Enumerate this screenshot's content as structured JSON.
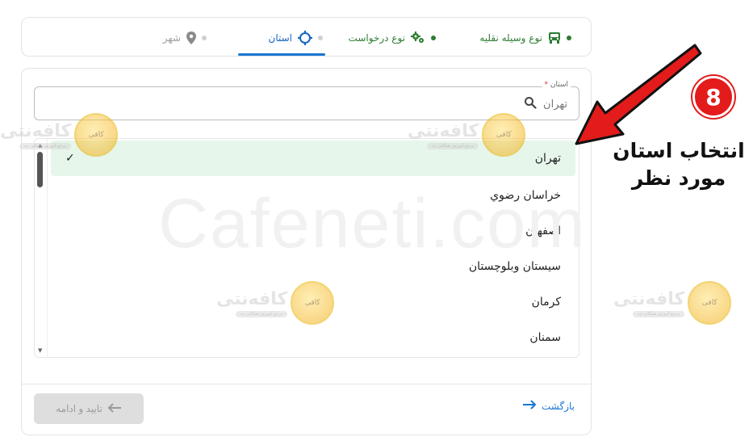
{
  "stepper": {
    "steps": [
      {
        "label": "نوع وسیله نقلیه",
        "icon": "car-icon",
        "state": "done"
      },
      {
        "label": "نوع درخواست",
        "icon": "gears-icon",
        "state": "done"
      },
      {
        "label": "استان",
        "icon": "crosshair-icon",
        "state": "current"
      },
      {
        "label": "شهر",
        "icon": "map-pin-icon",
        "state": "pending"
      }
    ]
  },
  "province_field": {
    "label": "استان",
    "required_mark": "*",
    "value": "تهران",
    "icon": "search-icon"
  },
  "province_list": {
    "options": [
      {
        "label": "تهران",
        "selected": true,
        "check": "✓"
      },
      {
        "label": "خراسان رضوي",
        "selected": false
      },
      {
        "label": "اصفهان",
        "selected": false
      },
      {
        "label": "سیستان وبلوچستان",
        "selected": false
      },
      {
        "label": "کرمان",
        "selected": false
      },
      {
        "label": "سمنان",
        "selected": false
      }
    ]
  },
  "footer": {
    "back_label": "بازگشت",
    "confirm_label": "تایید و ادامه"
  },
  "annotation": {
    "number": "8",
    "line1": "انتخاب استان",
    "line2": "مورد نظر",
    "color": "#e31b1b"
  },
  "watermark": {
    "text": "Cafeneti.com",
    "logo_word": "کافه‌نتی",
    "logo_tagline": "مرجع آموزش همگانی نت",
    "coin_text": "کافی"
  },
  "colors": {
    "done": "#2e7d32",
    "current": "#1565c0",
    "selected_row": "#e6f6ea"
  }
}
